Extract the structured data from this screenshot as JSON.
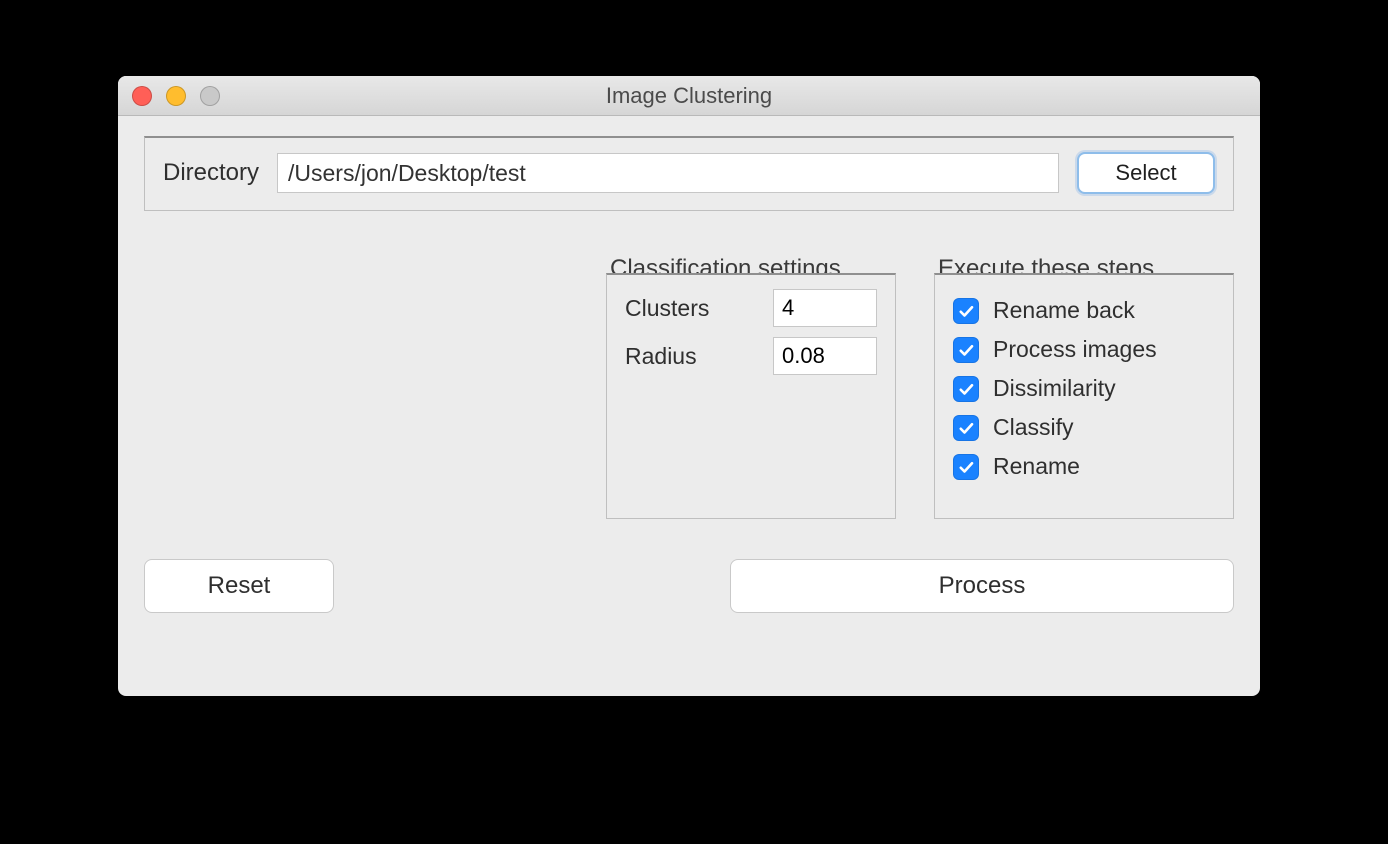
{
  "window": {
    "title": "Image Clustering"
  },
  "directory": {
    "label": "Directory",
    "value": "/Users/jon/Desktop/test",
    "select_label": "Select"
  },
  "settings": {
    "title": "Classification settings",
    "clusters_label": "Clusters",
    "clusters_value": "4",
    "radius_label": "Radius",
    "radius_value": "0.08"
  },
  "steps": {
    "title": "Execute these steps",
    "items": [
      {
        "label": "Rename back",
        "checked": true
      },
      {
        "label": "Process images",
        "checked": true
      },
      {
        "label": "Dissimilarity",
        "checked": true
      },
      {
        "label": "Classify",
        "checked": true
      },
      {
        "label": "Rename",
        "checked": true
      }
    ]
  },
  "buttons": {
    "reset": "Reset",
    "process": "Process"
  }
}
